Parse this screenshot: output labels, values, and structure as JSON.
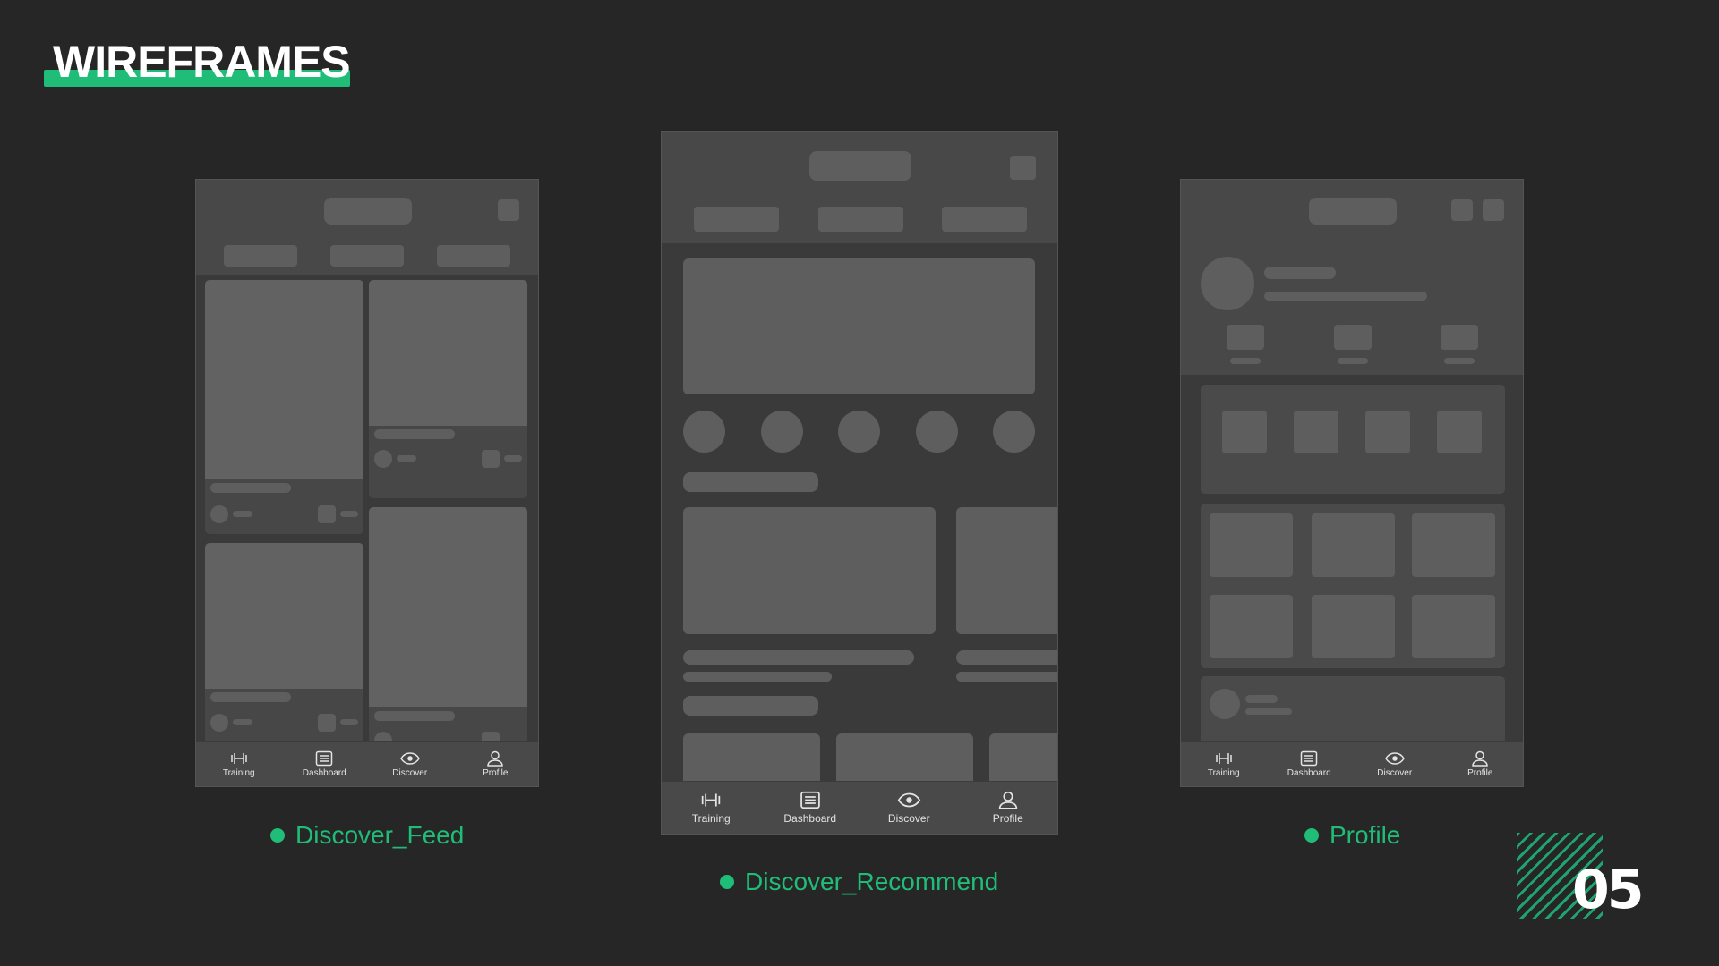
{
  "page": {
    "title": "WIREFRAMES",
    "page_number": "05",
    "accent_color": "#1fbd78"
  },
  "screens": [
    {
      "caption": "Discover_Feed"
    },
    {
      "caption": "Discover_Recommend"
    },
    {
      "caption": "Profile"
    }
  ],
  "tabbar": {
    "items": [
      {
        "label": "Training",
        "icon": "dumbbell-icon"
      },
      {
        "label": "Dashboard",
        "icon": "list-icon"
      },
      {
        "label": "Discover",
        "icon": "eye-icon"
      },
      {
        "label": "Profile",
        "icon": "user-icon"
      }
    ]
  }
}
